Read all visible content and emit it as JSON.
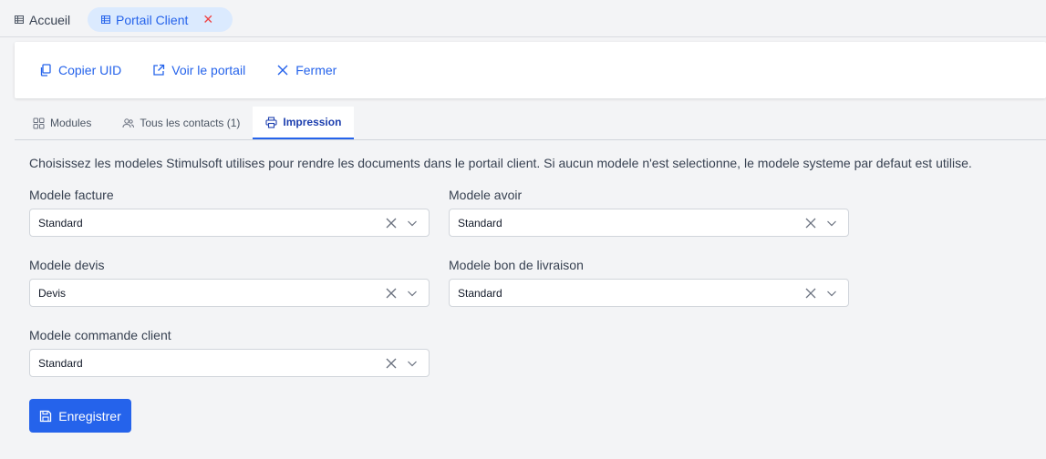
{
  "tabs": {
    "home_label": "Accueil",
    "portal_label": "Portail Client",
    "close_symbol": "✕"
  },
  "actions": {
    "copy_uid": "Copier UID",
    "view_portal": "Voir le portail",
    "close": "Fermer"
  },
  "subtabs": {
    "modules": "Modules",
    "contacts": "Tous les contacts (1)",
    "printing": "Impression"
  },
  "content": {
    "description": "Choisissez les modeles Stimulsoft utilises pour rendre les documents dans le portail client. Si aucun modele n'est selectionne, le modele systeme par defaut est utilise.",
    "fields": {
      "invoice": {
        "label": "Modele facture",
        "value": "Standard"
      },
      "credit": {
        "label": "Modele avoir",
        "value": "Standard"
      },
      "quote": {
        "label": "Modele devis",
        "value": "Devis"
      },
      "delivery": {
        "label": "Modele bon de livraison",
        "value": "Standard"
      },
      "order": {
        "label": "Modele commande client",
        "value": "Standard"
      }
    },
    "save_label": "Enregistrer"
  },
  "colors": {
    "accent": "#2563eb",
    "active_tab_bg": "#dbeafe",
    "close_red": "#ef4444",
    "page_bg": "#f3f4f6"
  },
  "icons": {
    "home_tab": "table-icon",
    "portal_tab": "table-icon",
    "copy": "copy-icon",
    "view": "external-link-icon",
    "close": "close-icon",
    "modules": "grid-icon",
    "contacts": "users-icon",
    "printing": "printer-icon",
    "clear": "clear-icon",
    "dropdown": "chevron-down-icon",
    "save": "save-icon"
  }
}
